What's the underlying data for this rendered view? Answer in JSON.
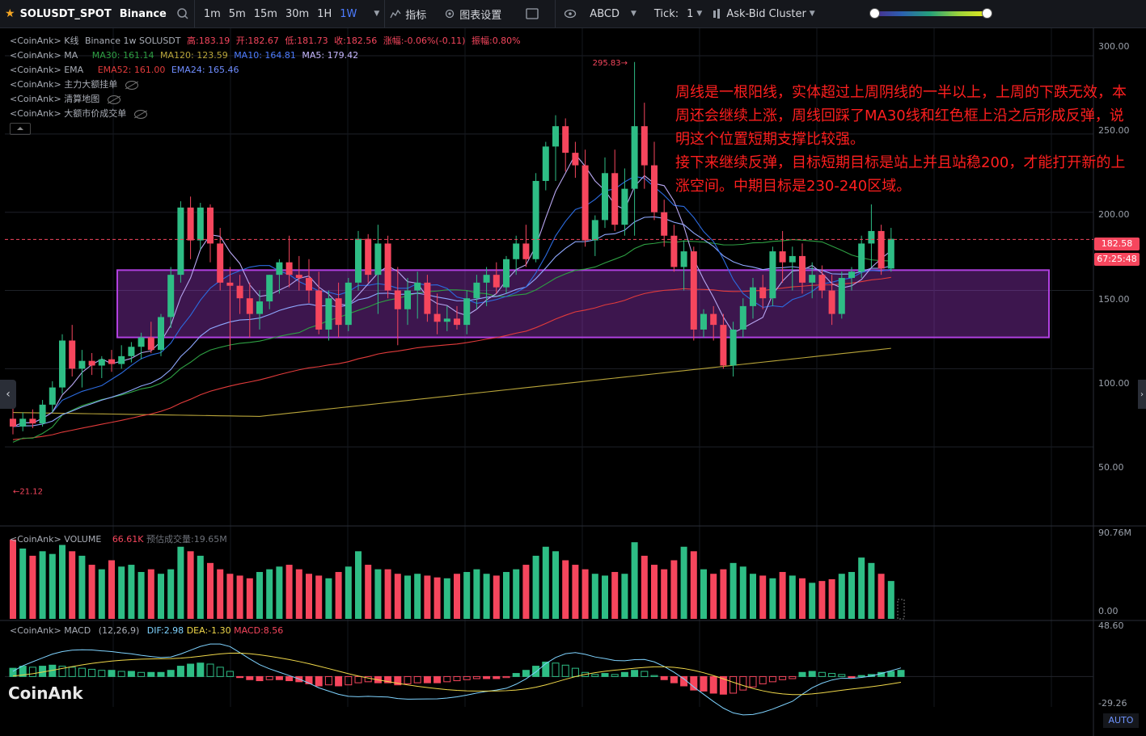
{
  "toolbar": {
    "symbol": "SOLUSDT_SPOT",
    "exchange": "Binance",
    "intervals": [
      "1m",
      "5m",
      "15m",
      "30m",
      "1H",
      "1W"
    ],
    "active_interval": "1W",
    "indicators_label": "指标",
    "chart_settings_label": "图表设置",
    "abcd_label": "ABCD",
    "tick_label": "Tick:",
    "tick_value": "1",
    "cluster_label": "Ask-Bid Cluster"
  },
  "legend": {
    "kline": {
      "prefix": "<CoinAnk> K线",
      "source": "Binance 1w SOLUSDT",
      "high": "高:183.19",
      "open": "开:182.67",
      "low": "低:181.73",
      "close": "收:182.56",
      "change": "涨幅:-0.06%(-0.11)",
      "amp": "振幅:0.80%"
    },
    "ma": {
      "prefix": "<CoinAnk> MA",
      "ma30": "MA30: 161.14",
      "ma120": "MA120: 123.59",
      "ma10": "MA10: 164.81",
      "ma5": "MA5: 179.42"
    },
    "ema": {
      "prefix": "<CoinAnk> EMA",
      "ema52": "EMA52: 161.00",
      "ema24": "EMA24: 165.46"
    },
    "ind1": "<CoinAnk> 主力大额挂单",
    "ind2": "<CoinAnk> 清算地图",
    "ind3": "<CoinAnk> 大额市价成交单"
  },
  "volume_legend": {
    "prefix": "<CoinAnk> VOLUME",
    "value": "66.61K",
    "predicted": "预估成交量:19.65M"
  },
  "macd_legend": {
    "prefix": "<CoinAnk> MACD",
    "params": "(12,26,9)",
    "dif": "DIF:2.98",
    "dea": "DEA:-1.30",
    "macd": "MACD:8.56"
  },
  "annotation": {
    "line1": "周线是一根阳线，实体超过上周阴线的一半以上，上周的下跌无效，本周还会继续上涨，周线回踩了MA30线和红色框上沿之后形成反弹，说明这个位置短期支撑比较强。",
    "line2": "接下来继续反弹，目标短期目标是站上并且站稳200，才能打开新的上涨空间。中期目标是230-240区域。"
  },
  "price_axis": {
    "ticks": [
      "300.00",
      "250.00",
      "200.00",
      "150.00",
      "100.00",
      "50.00"
    ]
  },
  "volume_axis": {
    "top": "90.76M",
    "bottom": "0.00"
  },
  "macd_axis": {
    "top": "48.60",
    "bottom": "-29.26"
  },
  "last_price": "182.58",
  "countdown": "67:25:48",
  "high_marker": "295.83",
  "low_marker": "21.12",
  "logo": "CoinAnk",
  "auto_label": "AUTO",
  "colors": {
    "up": "#2ebd85",
    "down": "#f6465d",
    "ma30": "#2ea043",
    "ma120": "#b9a53a",
    "ma10": "#2c6be0",
    "ma5": "#b7a6f0",
    "ema52": "#e23b3b",
    "ema24": "#8fa8ff",
    "box": "#b040e0",
    "annotation": "#ff1f1f"
  },
  "chart_data": {
    "type": "candlestick",
    "price_ylim": [
      0,
      315
    ],
    "bars": [
      {
        "o": 68,
        "h": 75,
        "l": 58,
        "c": 63
      },
      {
        "o": 63,
        "h": 72,
        "l": 60,
        "c": 68
      },
      {
        "o": 68,
        "h": 74,
        "l": 62,
        "c": 65
      },
      {
        "o": 65,
        "h": 80,
        "l": 63,
        "c": 77
      },
      {
        "o": 77,
        "h": 92,
        "l": 72,
        "c": 88
      },
      {
        "o": 88,
        "h": 122,
        "l": 84,
        "c": 118
      },
      {
        "o": 118,
        "h": 128,
        "l": 95,
        "c": 100
      },
      {
        "o": 100,
        "h": 112,
        "l": 88,
        "c": 105
      },
      {
        "o": 105,
        "h": 110,
        "l": 96,
        "c": 102
      },
      {
        "o": 102,
        "h": 108,
        "l": 94,
        "c": 106
      },
      {
        "o": 106,
        "h": 112,
        "l": 98,
        "c": 103
      },
      {
        "o": 103,
        "h": 115,
        "l": 100,
        "c": 108
      },
      {
        "o": 108,
        "h": 117,
        "l": 104,
        "c": 114
      },
      {
        "o": 114,
        "h": 123,
        "l": 106,
        "c": 120
      },
      {
        "o": 120,
        "h": 130,
        "l": 110,
        "c": 112
      },
      {
        "o": 112,
        "h": 135,
        "l": 108,
        "c": 133
      },
      {
        "o": 133,
        "h": 165,
        "l": 126,
        "c": 160
      },
      {
        "o": 160,
        "h": 207,
        "l": 155,
        "c": 203
      },
      {
        "o": 203,
        "h": 210,
        "l": 170,
        "c": 182
      },
      {
        "o": 182,
        "h": 206,
        "l": 176,
        "c": 203
      },
      {
        "o": 203,
        "h": 205,
        "l": 168,
        "c": 180
      },
      {
        "o": 180,
        "h": 190,
        "l": 150,
        "c": 155
      },
      {
        "o": 155,
        "h": 165,
        "l": 112,
        "c": 153
      },
      {
        "o": 153,
        "h": 160,
        "l": 135,
        "c": 145
      },
      {
        "o": 145,
        "h": 155,
        "l": 120,
        "c": 135
      },
      {
        "o": 135,
        "h": 150,
        "l": 125,
        "c": 143
      },
      {
        "o": 143,
        "h": 160,
        "l": 138,
        "c": 160
      },
      {
        "o": 160,
        "h": 170,
        "l": 148,
        "c": 168
      },
      {
        "o": 168,
        "h": 185,
        "l": 152,
        "c": 160
      },
      {
        "o": 160,
        "h": 172,
        "l": 150,
        "c": 158
      },
      {
        "o": 158,
        "h": 170,
        "l": 142,
        "c": 150
      },
      {
        "o": 150,
        "h": 162,
        "l": 122,
        "c": 125
      },
      {
        "o": 125,
        "h": 150,
        "l": 118,
        "c": 145
      },
      {
        "o": 145,
        "h": 155,
        "l": 120,
        "c": 128
      },
      {
        "o": 128,
        "h": 158,
        "l": 124,
        "c": 155
      },
      {
        "o": 155,
        "h": 188,
        "l": 150,
        "c": 183
      },
      {
        "o": 183,
        "h": 186,
        "l": 155,
        "c": 160
      },
      {
        "o": 160,
        "h": 192,
        "l": 135,
        "c": 180
      },
      {
        "o": 180,
        "h": 185,
        "l": 145,
        "c": 150
      },
      {
        "o": 150,
        "h": 165,
        "l": 115,
        "c": 138
      },
      {
        "o": 138,
        "h": 158,
        "l": 128,
        "c": 150
      },
      {
        "o": 150,
        "h": 162,
        "l": 132,
        "c": 155
      },
      {
        "o": 155,
        "h": 160,
        "l": 130,
        "c": 135
      },
      {
        "o": 135,
        "h": 148,
        "l": 122,
        "c": 130
      },
      {
        "o": 130,
        "h": 140,
        "l": 124,
        "c": 132
      },
      {
        "o": 132,
        "h": 140,
        "l": 125,
        "c": 128
      },
      {
        "o": 128,
        "h": 150,
        "l": 122,
        "c": 145
      },
      {
        "o": 145,
        "h": 160,
        "l": 138,
        "c": 155
      },
      {
        "o": 155,
        "h": 165,
        "l": 140,
        "c": 160
      },
      {
        "o": 160,
        "h": 168,
        "l": 148,
        "c": 152
      },
      {
        "o": 152,
        "h": 172,
        "l": 148,
        "c": 170
      },
      {
        "o": 170,
        "h": 185,
        "l": 160,
        "c": 180
      },
      {
        "o": 180,
        "h": 192,
        "l": 165,
        "c": 170
      },
      {
        "o": 170,
        "h": 225,
        "l": 168,
        "c": 220
      },
      {
        "o": 220,
        "h": 245,
        "l": 214,
        "c": 242
      },
      {
        "o": 242,
        "h": 262,
        "l": 220,
        "c": 255
      },
      {
        "o": 255,
        "h": 260,
        "l": 226,
        "c": 238
      },
      {
        "o": 238,
        "h": 245,
        "l": 222,
        "c": 230
      },
      {
        "o": 230,
        "h": 240,
        "l": 178,
        "c": 182
      },
      {
        "o": 182,
        "h": 198,
        "l": 172,
        "c": 195
      },
      {
        "o": 195,
        "h": 235,
        "l": 190,
        "c": 225
      },
      {
        "o": 225,
        "h": 240,
        "l": 188,
        "c": 192
      },
      {
        "o": 192,
        "h": 228,
        "l": 185,
        "c": 215
      },
      {
        "o": 215,
        "h": 296,
        "l": 185,
        "c": 255
      },
      {
        "o": 255,
        "h": 270,
        "l": 215,
        "c": 230
      },
      {
        "o": 230,
        "h": 245,
        "l": 195,
        "c": 200
      },
      {
        "o": 200,
        "h": 208,
        "l": 178,
        "c": 185
      },
      {
        "o": 185,
        "h": 192,
        "l": 162,
        "c": 165
      },
      {
        "o": 165,
        "h": 182,
        "l": 150,
        "c": 175
      },
      {
        "o": 175,
        "h": 178,
        "l": 118,
        "c": 125
      },
      {
        "o": 125,
        "h": 138,
        "l": 120,
        "c": 135
      },
      {
        "o": 135,
        "h": 140,
        "l": 118,
        "c": 128
      },
      {
        "o": 128,
        "h": 135,
        "l": 100,
        "c": 102
      },
      {
        "o": 102,
        "h": 130,
        "l": 95,
        "c": 125
      },
      {
        "o": 125,
        "h": 145,
        "l": 120,
        "c": 140
      },
      {
        "o": 140,
        "h": 158,
        "l": 132,
        "c": 152
      },
      {
        "o": 152,
        "h": 160,
        "l": 138,
        "c": 145
      },
      {
        "o": 145,
        "h": 178,
        "l": 140,
        "c": 175
      },
      {
        "o": 175,
        "h": 188,
        "l": 155,
        "c": 168
      },
      {
        "o": 168,
        "h": 178,
        "l": 150,
        "c": 172
      },
      {
        "o": 172,
        "h": 180,
        "l": 148,
        "c": 155
      },
      {
        "o": 155,
        "h": 168,
        "l": 145,
        "c": 160
      },
      {
        "o": 160,
        "h": 166,
        "l": 145,
        "c": 150
      },
      {
        "o": 150,
        "h": 160,
        "l": 128,
        "c": 135
      },
      {
        "o": 135,
        "h": 162,
        "l": 132,
        "c": 158
      },
      {
        "o": 158,
        "h": 165,
        "l": 150,
        "c": 162
      },
      {
        "o": 162,
        "h": 185,
        "l": 158,
        "c": 180
      },
      {
        "o": 180,
        "h": 205,
        "l": 165,
        "c": 188
      },
      {
        "o": 188,
        "h": 192,
        "l": 160,
        "c": 164
      },
      {
        "o": 164,
        "h": 190,
        "l": 162,
        "c": 183
      }
    ],
    "volume": [
      88,
      78,
      70,
      75,
      72,
      82,
      75,
      70,
      60,
      55,
      65,
      58,
      60,
      52,
      55,
      50,
      55,
      80,
      75,
      70,
      62,
      55,
      50,
      48,
      45,
      52,
      55,
      58,
      60,
      55,
      50,
      48,
      45,
      52,
      58,
      75,
      60,
      55,
      55,
      50,
      48,
      50,
      48,
      46,
      45,
      50,
      52,
      55,
      50,
      48,
      52,
      55,
      60,
      70,
      80,
      75,
      65,
      60,
      55,
      50,
      48,
      52,
      50,
      85,
      70,
      60,
      55,
      65,
      80,
      75,
      55,
      50,
      55,
      62,
      58,
      50,
      48,
      45,
      52,
      48,
      45,
      40,
      42,
      44,
      50,
      52,
      68,
      62,
      50,
      42,
      0
    ],
    "macd_hist": [
      8,
      10,
      9,
      10,
      11,
      10,
      9,
      8,
      7,
      6,
      6,
      5,
      5,
      4,
      4,
      4,
      6,
      10,
      12,
      13,
      12,
      9,
      5,
      -1,
      -3,
      -4,
      -3,
      -3,
      -4,
      -5,
      -7,
      -9,
      -8,
      -9,
      -8,
      -6,
      -5,
      -6,
      -6,
      -8,
      -7,
      -6,
      -6,
      -6,
      -5,
      -4,
      -3,
      -2,
      -2,
      -2,
      -1,
      3,
      6,
      10,
      14,
      13,
      11,
      8,
      4,
      2,
      3,
      2,
      4,
      6,
      5,
      1,
      -3,
      -6,
      -9,
      -13,
      -14,
      -16,
      -17,
      -16,
      -13,
      -10,
      -7,
      -5,
      -3,
      -2,
      4,
      5,
      4,
      3,
      2,
      -1,
      1,
      2,
      4,
      5,
      6
    ],
    "ylim_macd": [
      -29.26,
      48.6
    ]
  }
}
